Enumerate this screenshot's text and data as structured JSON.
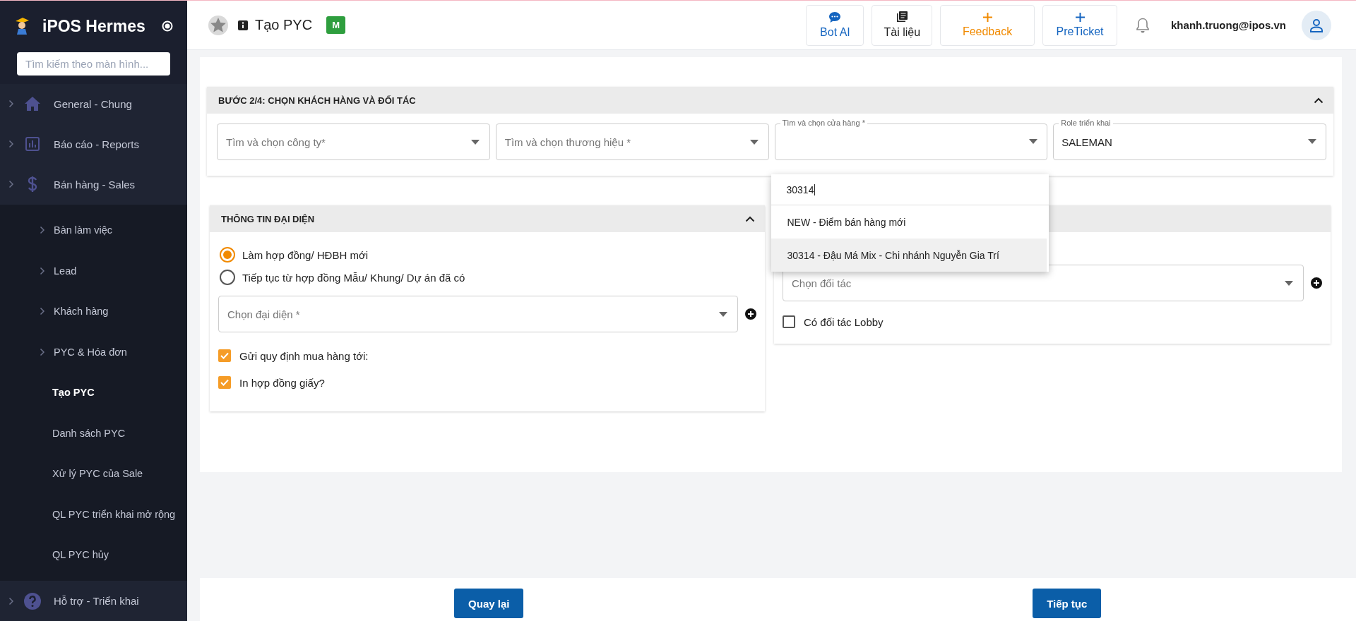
{
  "sidebar": {
    "app_title": "iPOS Hermes",
    "search": {
      "placeholder": "Tìm kiếm theo màn hình..."
    },
    "items": [
      {
        "label": "General - Chung",
        "expanded": false
      },
      {
        "label": "Báo cáo - Reports",
        "expanded": false
      },
      {
        "label": "Bán hàng - Sales",
        "expanded": true,
        "children": [
          {
            "label": "Bàn làm việc",
            "kind": "group",
            "selected": false
          },
          {
            "label": "Lead",
            "kind": "group",
            "selected": false
          },
          {
            "label": "Khách hàng",
            "kind": "group",
            "selected": false
          },
          {
            "label": "PYC & Hóa đơn",
            "kind": "group",
            "selected": false
          },
          {
            "label": "Tạo PYC",
            "kind": "link",
            "selected": true
          },
          {
            "label": "Danh sách PYC",
            "kind": "link",
            "selected": false
          },
          {
            "label": "Xử lý PYC của Sale",
            "kind": "link",
            "selected": false
          },
          {
            "label": "QL PYC triển khai mở rộng",
            "kind": "link",
            "selected": false
          },
          {
            "label": "QL PYC hủy",
            "kind": "link",
            "selected": false
          }
        ]
      },
      {
        "label": "Hỗ trợ - Triển khai",
        "expanded": false
      }
    ]
  },
  "header": {
    "title": "Tạo PYC",
    "badge": "M",
    "actions": [
      {
        "label": "Bot AI",
        "color": "#1565c0"
      },
      {
        "label": "Tài liệu",
        "color": "#212121"
      },
      {
        "label": "Feedback",
        "color": "#f18a00"
      },
      {
        "label": "PreTicket",
        "color": "#1565c0"
      }
    ],
    "user_email": "khanh.truong@ipos.vn"
  },
  "step": {
    "title": "BƯỚC 2/4: CHỌN KHÁCH HÀNG VÀ ĐỐI TÁC",
    "expanded": true,
    "fields": [
      {
        "placeholder": "Tìm và chọn công ty*"
      },
      {
        "placeholder": "Tìm và chọn thương hiệu *"
      },
      {
        "label": "Tìm và chọn cửa hàng *",
        "open": true
      },
      {
        "label": "Role triển khai",
        "value": "SALEMAN"
      }
    ]
  },
  "dropdown": {
    "search_value": "30314",
    "options": [
      {
        "label": "NEW - Điểm bán hàng mới",
        "selected": false
      },
      {
        "label": "30314 - Đậu Má Mix - Chi nhánh Nguyễn Gia Trí",
        "selected": true
      }
    ]
  },
  "representative": {
    "title": "THÔNG TIN ĐẠI DIỆN",
    "expanded": true,
    "radios": [
      {
        "label": "Làm hợp đồng/ HĐBH mới",
        "selected": true
      },
      {
        "label": "Tiếp tục từ hợp đồng Mẫu/ Khung/ Dự án đã có",
        "selected": false
      }
    ],
    "select": {
      "placeholder": "Chọn đại diện *"
    },
    "checkboxes": [
      {
        "label": "Gửi quy định mua hàng tới:",
        "checked": true
      },
      {
        "label": "In hợp đồng giấy?",
        "checked": true
      }
    ]
  },
  "partner": {
    "select": {
      "placeholder": "Chọn đối tác"
    },
    "checkboxes": [
      {
        "label": "Có đối tác Lobby",
        "checked": false
      }
    ]
  },
  "footer": {
    "buttons": [
      "Quay lại",
      "Tiếp tục"
    ]
  }
}
